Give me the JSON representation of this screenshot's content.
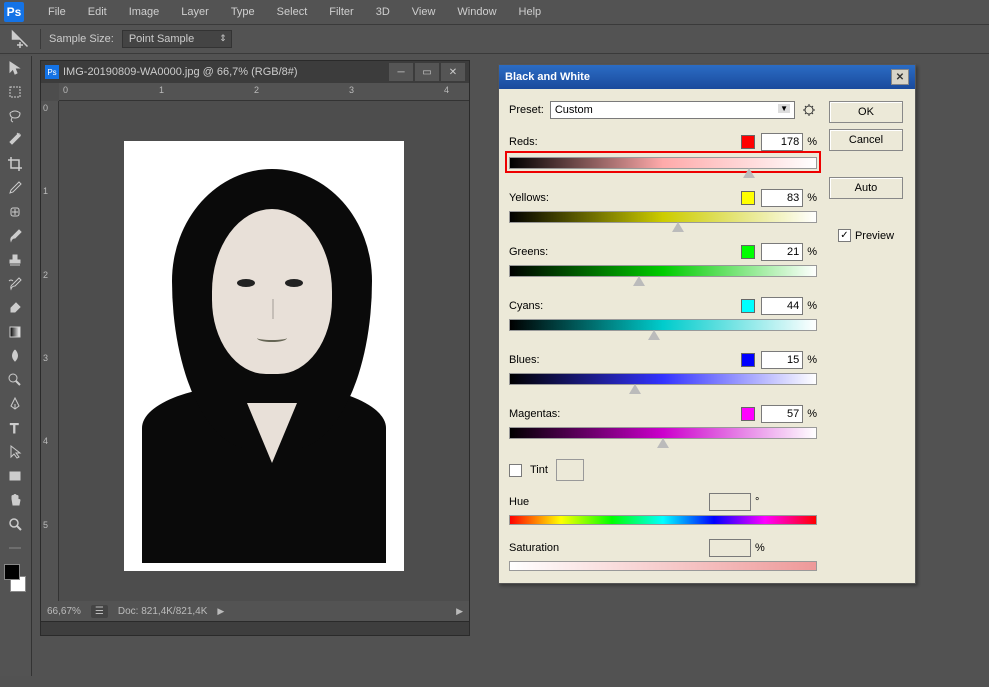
{
  "app": {
    "name": "Ps"
  },
  "menu": {
    "items": [
      "File",
      "Edit",
      "Image",
      "Layer",
      "Type",
      "Select",
      "Filter",
      "3D",
      "View",
      "Window",
      "Help"
    ]
  },
  "options": {
    "sample_size_label": "Sample Size:",
    "sample_size_value": "Point Sample"
  },
  "doc": {
    "title": "IMG-20190809-WA0000.jpg @ 66,7% (RGB/8#)",
    "zoom": "66,67%",
    "doc_info": "Doc: 821,4K/821,4K",
    "ruler_h": [
      "0",
      "1",
      "2",
      "3",
      "4"
    ],
    "ruler_v": [
      "0",
      "1",
      "2",
      "3",
      "4",
      "5"
    ]
  },
  "dialog": {
    "title": "Black and White",
    "preset_label": "Preset:",
    "preset_value": "Custom",
    "ok": "OK",
    "cancel": "Cancel",
    "auto": "Auto",
    "preview": "Preview",
    "sliders": [
      {
        "name": "Reds:",
        "color": "#ff0000",
        "value": "178",
        "gradient": "linear-gradient(to right,#000,#faa,#fff)",
        "pos": 78,
        "hl": true
      },
      {
        "name": "Yellows:",
        "color": "#ffff00",
        "value": "83",
        "gradient": "linear-gradient(to right,#000,#cc0,#fff)",
        "pos": 55
      },
      {
        "name": "Greens:",
        "color": "#00ff00",
        "value": "21",
        "gradient": "linear-gradient(to right,#000,#0c0,#fff)",
        "pos": 42
      },
      {
        "name": "Cyans:",
        "color": "#00ffff",
        "value": "44",
        "gradient": "linear-gradient(to right,#000,#0cc,#fff)",
        "pos": 47
      },
      {
        "name": "Blues:",
        "color": "#0000ff",
        "value": "15",
        "gradient": "linear-gradient(to right,#000,#33f,#fff)",
        "pos": 41
      },
      {
        "name": "Magentas:",
        "color": "#ff00ff",
        "value": "57",
        "gradient": "linear-gradient(to right,#000,#c0c,#fff)",
        "pos": 50
      }
    ],
    "tint_label": "Tint",
    "hue_label": "Hue",
    "hue_unit": "°",
    "saturation_label": "Saturation",
    "pct": "%"
  }
}
